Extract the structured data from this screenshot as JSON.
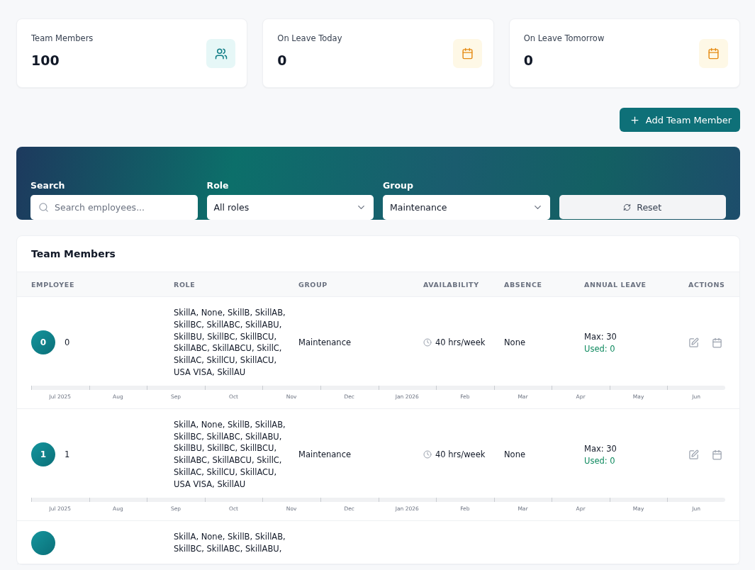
{
  "stats": [
    {
      "label": "Team Members",
      "value": "100",
      "kind": "people"
    },
    {
      "label": "On Leave Today",
      "value": "0",
      "kind": "calendar"
    },
    {
      "label": "On Leave Tomorrow",
      "value": "0",
      "kind": "calendar"
    }
  ],
  "add_button": "Add Team Member",
  "filters": {
    "search": {
      "label": "Search",
      "placeholder": "Search employees..."
    },
    "role": {
      "label": "Role",
      "value": "All roles"
    },
    "group": {
      "label": "Group",
      "value": "Maintenance"
    },
    "reset": "Reset"
  },
  "table": {
    "title": "Team Members",
    "columns": [
      "EMPLOYEE",
      "ROLE",
      "GROUP",
      "AVAILABILITY",
      "ABSENCE",
      "ANNUAL LEAVE",
      "ACTIONS"
    ],
    "rows": [
      {
        "initial": "0",
        "name": "0",
        "role": "SkillA, None, SkillB, SkillAB, SkillBC, SkillABC, SkillABU, SkillBU, SkillBC, SkillBCU, SkillABC, SkillABCU, SkillC, SkillAC, SkillCU, SkillACU, USA VISA, SkillAU",
        "group": "Maintenance",
        "availability": "40 hrs/week",
        "absence": "None",
        "leave_max": "Max: 30",
        "leave_used": "Used: 0",
        "months": [
          "Jul 2025",
          "Aug",
          "Sep",
          "Oct",
          "Nov",
          "Dec",
          "Jan 2026",
          "Feb",
          "Mar",
          "Apr",
          "May",
          "Jun"
        ]
      },
      {
        "initial": "1",
        "name": "1",
        "role": "SkillA, None, SkillB, SkillAB, SkillBC, SkillABC, SkillABU, SkillBU, SkillBC, SkillBCU, SkillABC, SkillABCU, SkillC, SkillAC, SkillCU, SkillACU, USA VISA, SkillAU",
        "group": "Maintenance",
        "availability": "40 hrs/week",
        "absence": "None",
        "leave_max": "Max: 30",
        "leave_used": "Used: 0",
        "months": [
          "Jul 2025",
          "Aug",
          "Sep",
          "Oct",
          "Nov",
          "Dec",
          "Jan 2026",
          "Feb",
          "Mar",
          "Apr",
          "May",
          "Jun"
        ]
      },
      {
        "role": "SkillA, None, SkillB, SkillAB, SkillBC, SkillABC, SkillABU,"
      }
    ]
  }
}
